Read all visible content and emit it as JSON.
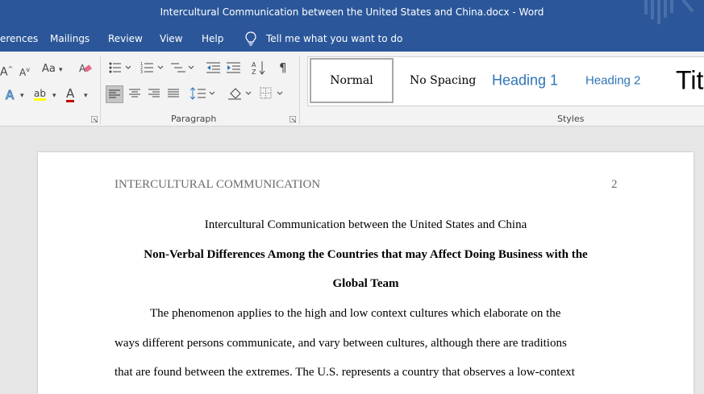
{
  "window": {
    "title": "Intercultural Communication between the United States and China.docx  -  Word"
  },
  "menu": {
    "items": [
      "erences",
      "Mailings",
      "Review",
      "View",
      "Help"
    ],
    "tell_me": "Tell me what you want to do"
  },
  "ribbon": {
    "font_group": {
      "grow_font": "A",
      "shrink_font": "A",
      "change_case": "Aa",
      "highlight": "ab",
      "font_color": "A",
      "font_color_hex": "#c00000",
      "highlight_hex": "#ffff00"
    },
    "paragraph_group": {
      "label": "Paragraph",
      "pilcrow": "¶"
    },
    "styles_group": {
      "label": "Styles",
      "items": [
        "Normal",
        "No Spacing",
        "Heading 1",
        "Heading 2",
        "Tit"
      ]
    }
  },
  "colors": {
    "brand": "#2b579a",
    "heading": "#2e74b5"
  },
  "document": {
    "header_text": "INTERCULTURAL COMMUNICATION",
    "page_number": "2",
    "title": "Intercultural Communication between the United States and China",
    "heading_line1": "Non-Verbal Differences Among the Countries that may Affect Doing Business with the",
    "heading_line2": "Global Team",
    "body_line1": "The phenomenon applies to the high and low context cultures which elaborate on the",
    "body_line2": "ways different persons communicate, and vary between cultures, although there are traditions",
    "body_line3": "that are found between the extremes. The U.S. represents a country that observes a low-context"
  }
}
